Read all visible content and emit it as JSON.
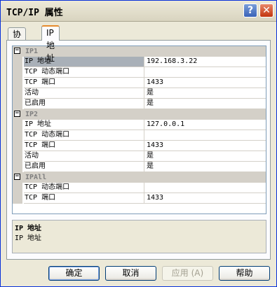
{
  "window": {
    "title": "TCP/IP 属性",
    "help_glyph": "?",
    "close_glyph": "✕"
  },
  "tabs": [
    {
      "label": "协议"
    },
    {
      "label": "IP 地址"
    }
  ],
  "grid": {
    "collapse_glyph": "−",
    "categories": [
      {
        "name": "IP1",
        "rows": [
          {
            "name": "IP 地址",
            "value": "192.168.3.22",
            "selected": true
          },
          {
            "name": "TCP 动态端口",
            "value": ""
          },
          {
            "name": "TCP 端口",
            "value": "1433"
          },
          {
            "name": "活动",
            "value": "是"
          },
          {
            "name": "已启用",
            "value": "是"
          }
        ]
      },
      {
        "name": "IP2",
        "rows": [
          {
            "name": "IP 地址",
            "value": "127.0.0.1"
          },
          {
            "name": "TCP 动态端口",
            "value": ""
          },
          {
            "name": "TCP 端口",
            "value": "1433"
          },
          {
            "name": "活动",
            "value": "是"
          },
          {
            "name": "已启用",
            "value": "是"
          }
        ]
      },
      {
        "name": "IPAll",
        "rows": [
          {
            "name": "TCP 动态端口",
            "value": ""
          },
          {
            "name": "TCP 端口",
            "value": "1433"
          }
        ]
      }
    ]
  },
  "description": {
    "title": "IP 地址",
    "text": "IP 地址"
  },
  "buttons": {
    "ok": "确定",
    "cancel": "取消",
    "apply": "应用 (A)",
    "help": "帮助"
  }
}
